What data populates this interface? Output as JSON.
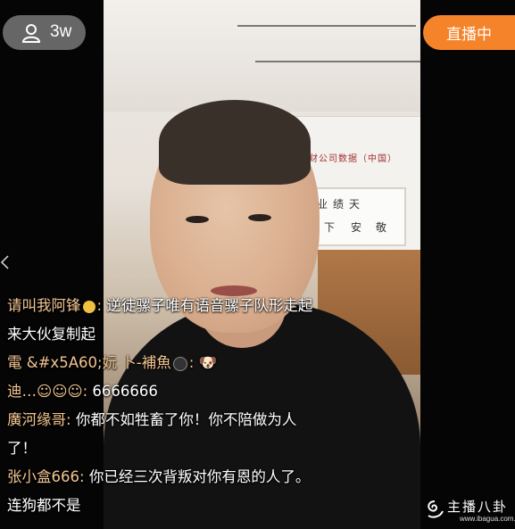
{
  "header": {
    "viewer_count": "3w",
    "live_button_label": "直播中"
  },
  "background": {
    "banner_text": "一家加财公司数据（中国）",
    "scroll_chars": [
      "业",
      "绩",
      "天",
      "下",
      "安",
      "敬"
    ]
  },
  "chat": {
    "messages": [
      {
        "user": "请叫我阿锋",
        "badge": "crown-badge-icon",
        "sep": ":",
        "text": "逆徒骡子唯有语音骡子队形走起",
        "text2": "来大伙复制起"
      },
      {
        "user": "電 &#x5A60;妧 卜-補魚",
        "badge": "soccer-ball-icon",
        "sep": ":",
        "text": "🐶",
        "text2": ""
      },
      {
        "user": "迪…☺☺☺",
        "badge": "",
        "sep": ":",
        "text": "6666666",
        "text2": ""
      },
      {
        "user": "廣河缘哥",
        "badge": "",
        "sep": ":",
        "text": "你都不如牲畜了你！你不陪做为人",
        "text2": "了！"
      },
      {
        "user": "张小盒666",
        "badge": "",
        "sep": ":",
        "text": "你已经三次背叛对你有恩的人了。",
        "text2": "连狗都不是"
      }
    ]
  },
  "watermark": {
    "brand": "主播八卦",
    "url": "www.ibagua.com.cn"
  },
  "colors": {
    "accent": "#f5832a",
    "username": "#f2c490",
    "pill": "#787878"
  }
}
